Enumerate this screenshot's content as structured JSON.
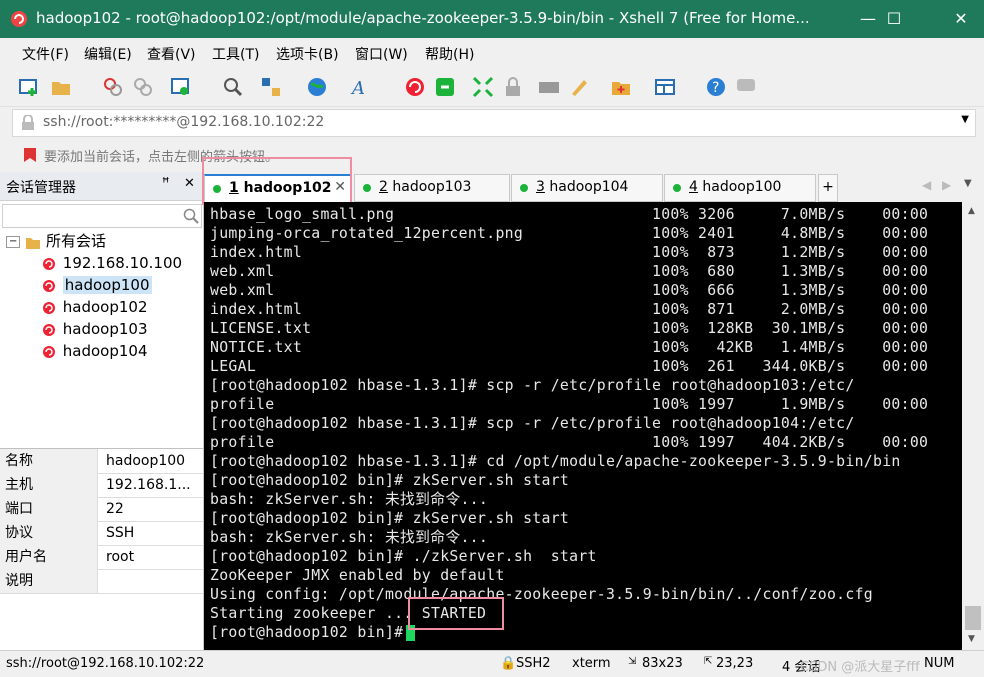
{
  "window": {
    "title": "hadoop102 - root@hadoop102:/opt/module/apache-zookeeper-3.5.9-bin/bin - Xshell 7 (Free for Home...",
    "minimize": "—",
    "maximize": "☐",
    "close": "✕"
  },
  "menu": [
    "文件(F)",
    "编辑(E)",
    "查看(V)",
    "工具(T)",
    "选项卡(B)",
    "窗口(W)",
    "帮助(H)"
  ],
  "address": {
    "value": "ssh://root:*********@192.168.10.102:22"
  },
  "hint": {
    "text": "要添加当前会话，点击左侧的箭头按钮。"
  },
  "session_manager": {
    "title": "会话管理器",
    "pin": "ᵖ",
    "close": "✕",
    "tree_root": "所有会话",
    "sessions": [
      "192.168.10.100",
      "hadoop100",
      "hadoop102",
      "hadoop103",
      "hadoop104"
    ],
    "selected": "hadoop100"
  },
  "properties": [
    {
      "key": "名称",
      "value": "hadoop100"
    },
    {
      "key": "主机",
      "value": "192.168.1..."
    },
    {
      "key": "端口",
      "value": "22"
    },
    {
      "key": "协议",
      "value": "SSH"
    },
    {
      "key": "用户名",
      "value": "root"
    },
    {
      "key": "说明",
      "value": ""
    }
  ],
  "tabs": [
    {
      "num": "1",
      "label": "hadoop102",
      "active": true
    },
    {
      "num": "2",
      "label": "hadoop103",
      "active": false
    },
    {
      "num": "3",
      "label": "hadoop104",
      "active": false
    },
    {
      "num": "4",
      "label": "hadoop100",
      "active": false
    }
  ],
  "tab_add": "+",
  "terminal_lines": [
    "hbase_logo_small.png                            100% 3206     7.0MB/s    00:00",
    "jumping-orca_rotated_12percent.png              100% 2401     4.8MB/s    00:00",
    "index.html                                      100%  873     1.2MB/s    00:00",
    "web.xml                                         100%  680     1.3MB/s    00:00",
    "web.xml                                         100%  666     1.3MB/s    00:00",
    "index.html                                      100%  871     2.0MB/s    00:00",
    "LICENSE.txt                                     100%  128KB  30.1MB/s    00:00",
    "NOTICE.txt                                      100%   42KB   1.4MB/s    00:00",
    "LEGAL                                           100%  261   344.0KB/s    00:00",
    "[root@hadoop102 hbase-1.3.1]# scp -r /etc/profile root@hadoop103:/etc/",
    "profile                                         100% 1997     1.9MB/s    00:00",
    "[root@hadoop102 hbase-1.3.1]# scp -r /etc/profile root@hadoop104:/etc/",
    "profile                                         100% 1997   404.2KB/s    00:00",
    "[root@hadoop102 hbase-1.3.1]# cd /opt/module/apache-zookeeper-3.5.9-bin/bin",
    "[root@hadoop102 bin]# zkServer.sh start",
    "bash: zkServer.sh: 未找到命令...",
    "[root@hadoop102 bin]# zkServer.sh start",
    "bash: zkServer.sh: 未找到命令...",
    "[root@hadoop102 bin]# ./zkServer.sh  start",
    "ZooKeeper JMX enabled by default",
    "Using config: /opt/module/apache-zookeeper-3.5.9-bin/bin/../conf/zoo.cfg",
    "Starting zookeeper ... STARTED",
    "[root@hadoop102 bin]# "
  ],
  "status": {
    "connection": "ssh://root@192.168.10.102:22",
    "protocol": "SSH2",
    "term": "xterm",
    "size": "83x23",
    "cursor": "23,23",
    "sessions": "4 会话",
    "numlock": "NUM",
    "watermark": "CSDN @派大星子fff"
  },
  "colors": {
    "titlebar": "#1f7a5c",
    "active_dot": "#1bb339",
    "cursor": "#1ed760",
    "highlight": "#f08ca0"
  }
}
